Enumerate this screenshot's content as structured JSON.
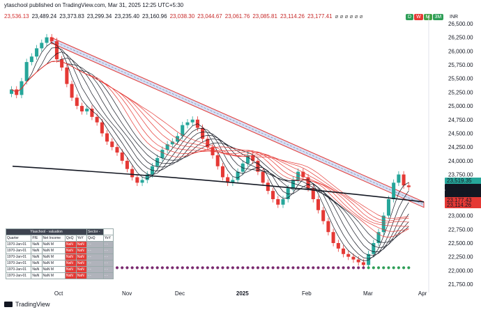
{
  "header": {
    "text": "ytaschool published on TradingView.com, Mar 31, 2025 12:25 UTC+5:30"
  },
  "indicator_values": [
    {
      "value": "23,536.13",
      "color": "#d32f2f"
    },
    {
      "value": "23,489.24",
      "color": "#131722"
    },
    {
      "value": "23,373.83",
      "color": "#131722"
    },
    {
      "value": "23,299.34",
      "color": "#131722"
    },
    {
      "value": "23,235.40",
      "color": "#131722"
    },
    {
      "value": "23,160.96",
      "color": "#131722"
    },
    {
      "value": "23,038.30",
      "color": "#c62828"
    },
    {
      "value": "23,044.67",
      "color": "#c62828"
    },
    {
      "value": "23,061.76",
      "color": "#c62828"
    },
    {
      "value": "23,085.81",
      "color": "#c62828"
    },
    {
      "value": "23,114.26",
      "color": "#c62828"
    },
    {
      "value": "23,177.41",
      "color": "#c62828"
    }
  ],
  "indicator_symbols": "⌀ ⌀ ⌀ ⌀ ⌀ ⌀",
  "timeframes": [
    "D",
    "W",
    "M",
    "3M"
  ],
  "currency": "INR",
  "colors": {
    "up": "#26a69a",
    "down": "#e53935",
    "accent_green": "#2e9e57",
    "channel": "#e53935",
    "ma_black": "#131722"
  },
  "chart_data": {
    "type": "candlestick",
    "y_ticks": [
      "26,500.00",
      "26,250.00",
      "26,000.00",
      "25,750.00",
      "25,500.00",
      "25,250.00",
      "25,000.00",
      "24,750.00",
      "24,500.00",
      "24,250.00",
      "24,000.00",
      "23,750.00",
      "23,500.00",
      "23,250.00",
      "23,000.00",
      "22,750.00",
      "22,500.00",
      "22,250.00",
      "22,000.00",
      "21,750.00"
    ],
    "x_ticks": [
      "Oct",
      "Nov",
      "Dec",
      "2025",
      "Feb",
      "Mar",
      "Apr"
    ],
    "ylim": [
      21700,
      26550
    ],
    "price_labels": [
      {
        "value": "23,519.35",
        "color": "#26a69a"
      },
      {
        "value": "23,406.37",
        "color": "#ffffff"
      },
      {
        "value": "23,299.34",
        "color": "#ffffff"
      },
      {
        "value": "23,235.40",
        "color": "#ffffff"
      },
      {
        "value": "23,177.43",
        "color": "#e53935"
      },
      {
        "value": "23,114.26",
        "color": "#e53935"
      }
    ],
    "closes": [
      25300,
      25200,
      25450,
      25800,
      25900,
      26050,
      26150,
      26250,
      26180,
      25850,
      25700,
      25400,
      25150,
      25000,
      24900,
      24950,
      24800,
      24700,
      24500,
      24350,
      24250,
      24150,
      24000,
      23850,
      23700,
      23600,
      23650,
      23750,
      23900,
      24050,
      24200,
      24300,
      24350,
      24450,
      24650,
      24700,
      24750,
      24600,
      24400,
      24250,
      24100,
      23900,
      23700,
      23600,
      23650,
      23800,
      23950,
      24100,
      24000,
      23800,
      23600,
      23450,
      23300,
      23200,
      23300,
      23500,
      23650,
      23800,
      23700,
      23500,
      23300,
      23100,
      22900,
      22700,
      22500,
      22400,
      22300,
      22250,
      22200,
      22150,
      22100,
      22300,
      22500,
      22700,
      23000,
      23300,
      23600,
      23750,
      23550,
      23520
    ],
    "ma_black_start": 23800,
    "ma_black_end": 23250,
    "channel_top_start": 26250,
    "channel_top_end": 23250,
    "channel_bot_start": 26150,
    "channel_bot_end": 23150
  },
  "table": {
    "title": "Ytaschool - valuation",
    "sector_label": "Sector -",
    "headers": [
      "Quarter",
      "P/E",
      "Net Income",
      "QoQ",
      "YoY",
      "QoQ",
      "YoY"
    ],
    "rows": [
      [
        "1970-Jan-01",
        "NaN",
        "NaN M",
        "NaN",
        "NaN",
        "- -",
        "- -"
      ],
      [
        "1970-Jan-01",
        "NaN",
        "NaN M",
        "NaN",
        "NaN",
        "- -",
        "- -"
      ],
      [
        "1970-Jan-01",
        "NaN",
        "NaN M",
        "NaN",
        "NaN",
        "- -",
        "- -"
      ],
      [
        "1970-Jan-01",
        "NaN",
        "NaN M",
        "NaN",
        "NaN",
        "- -",
        "- -"
      ],
      [
        "1970-Jan-01",
        "NaN",
        "NaN M",
        "NaN",
        "NaN",
        "- -",
        "- -"
      ],
      [
        "1970-Jan-01",
        "NaN",
        "NaN M",
        "NaN",
        "NaN",
        "- -",
        "- -"
      ]
    ]
  },
  "footer": {
    "brand": "TradingView"
  }
}
